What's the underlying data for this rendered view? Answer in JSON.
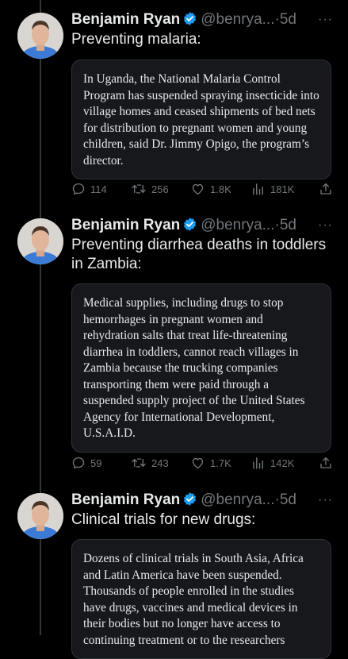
{
  "tweets": [
    {
      "author": "Benjamin Ryan",
      "handle": "@benrya...",
      "dot": "·",
      "time": "5d",
      "more": "···",
      "text": "Preventing malaria:",
      "quote": "In Uganda, the National Malaria Control Program has suspended spraying insecticide into village homes and ceased shipments of bed nets for distribution to pregnant women and young children, said Dr. Jimmy Opigo, the program’s director.",
      "replies": "114",
      "reposts": "256",
      "likes": "1.8K",
      "views": "181K"
    },
    {
      "author": "Benjamin Ryan",
      "handle": "@benrya...",
      "dot": "·",
      "time": "5d",
      "more": "···",
      "text": "Preventing diarrhea deaths in toddlers in Zambia:",
      "quote": "Medical supplies, including drugs to stop hemorrhages in pregnant women and rehydration salts that treat life-threatening diarrhea in toddlers, cannot reach villages in Zambia because the trucking companies transporting them were paid through a suspended supply project of the United States Agency for International Development, U.S.A.I.D.",
      "replies": "59",
      "reposts": "243",
      "likes": "1.7K",
      "views": "142K"
    },
    {
      "author": "Benjamin Ryan",
      "handle": "@benrya...",
      "dot": "·",
      "time": "5d",
      "more": "···",
      "text": "Clinical trials for new drugs:",
      "quote": "Dozens of clinical trials in South Asia, Africa and Latin America have been suspended. Thousands of people enrolled in the studies have drugs, vaccines and medical devices in their bodies but no longer have access to continuing treatment or to the researchers",
      "replies": "",
      "reposts": "",
      "likes": "",
      "views": ""
    }
  ],
  "colors": {
    "background": "#000000",
    "card": "#16181c",
    "text": "#e7e9ea",
    "muted": "#71767b",
    "verified": "#1d9bf0",
    "thread": "#333639"
  },
  "icons": [
    "verified-badge-icon",
    "reply-icon",
    "repost-icon",
    "like-icon",
    "views-icon",
    "share-icon",
    "more-icon"
  ]
}
